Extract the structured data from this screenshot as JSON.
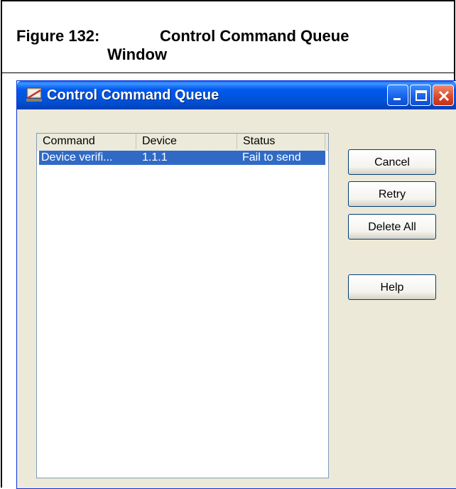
{
  "figure": {
    "label": "Figure 132:",
    "title_line1": "Control Command Queue",
    "title_line2": "Window"
  },
  "window": {
    "title": "Control Command Queue",
    "controls": [
      "minimize-icon",
      "maximize-icon",
      "close-icon"
    ]
  },
  "list": {
    "columns": [
      "Command",
      "Device",
      "Status"
    ],
    "rows": [
      {
        "command": "Device verifi...",
        "device": "1.1.1",
        "status": "Fail to send",
        "selected": true
      }
    ]
  },
  "buttons": {
    "cancel": "Cancel",
    "retry": "Retry",
    "delete_all": "Delete All",
    "help": "Help"
  },
  "colors": {
    "titlebar": "#0058ee",
    "selection": "#316ac5",
    "dialog_bg": "#ece9d8"
  }
}
